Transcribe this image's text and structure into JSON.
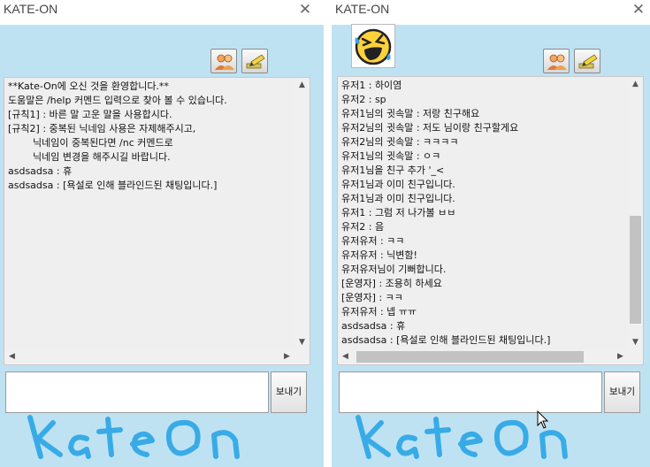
{
  "colors": {
    "window_bg": "#bfe2f3",
    "chat_bg": "#efefef",
    "logo": "#2aa6e6"
  },
  "left_window": {
    "title": "KATE-ON",
    "close_label": "✕",
    "send_label": "보내기",
    "input_value": "",
    "messages": [
      "**Kate-On에 오신 것을 환영합니다.**",
      "도움말은 /help 커멘드 입력으로 찾아 볼 수 있습니다.",
      "[규칙1] : 바른 말 고운 말을 사용합시다.",
      "[규칙2] : 중복된 닉네임 사용은 자제해주시고,",
      "        닉네임이 중복된다면 /nc 커멘드로",
      "        닉네임 변경을 해주시길 바랍니다.",
      "asdsadsa : 휴",
      "asdsadsa : [욕설로 인해 블라인드된 채팅입니다.]"
    ]
  },
  "right_window": {
    "title": "KATE-ON",
    "close_label": "✕",
    "send_label": "보내기",
    "input_value": "",
    "emoji_icon": "laughing-tears-emoji-icon",
    "messages": [
      "유저1 : 하이염",
      "유저2 : sp",
      "유저1님의 귓속말 : 저랑 친구해요",
      "유저2님의 귓속말 : 저도 님이랑 친구할게요",
      "유저2님의 귓속말 : ㅋㅋㅋㅋ",
      "유저1님의 귓속말 : ㅇㅋ",
      "유저1님을 친구 추가 '_<",
      "유저1님과 이미 친구입니다.",
      "유저1님과 이미 친구입니다.",
      "유저1 : 그럼 저 나가볼 ㅂㅂ",
      "유저2 : 음",
      "유저유저 : ㅋㅋ",
      "유저유저 : 닉변함!",
      "유저유저님이 기뻐합니다.",
      "[운영자] : 조용히 하세요",
      "[운영자] : ㅋㅋ",
      "유저유저 : 넵 ㅠㅠ",
      "asdsadsa : 휴",
      "asdsadsa : [욕설로 인해 블라인드된 채팅입니다.]"
    ]
  }
}
